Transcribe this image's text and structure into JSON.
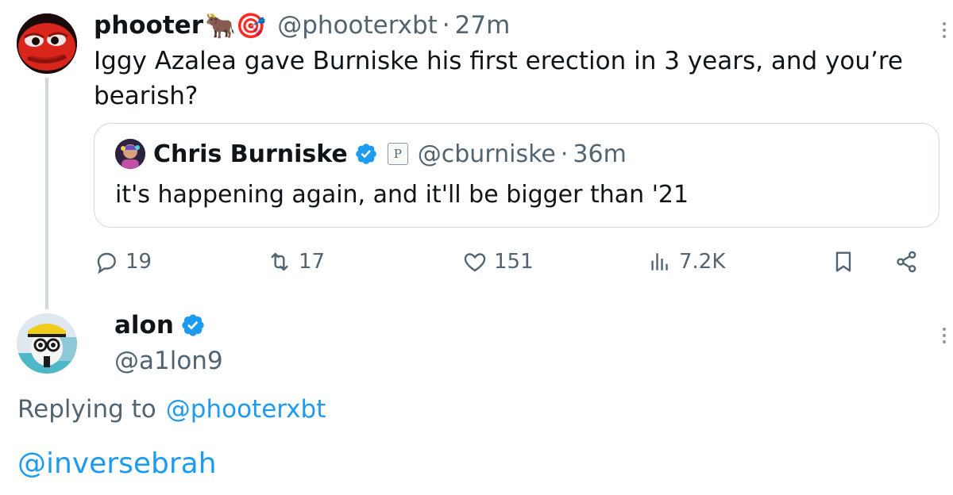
{
  "colors": {
    "text": "#0f1419",
    "secondary": "#536471",
    "link": "#1d9bf0",
    "border": "#cfd9de",
    "verified": "#1d9bf0"
  },
  "tweet": {
    "name": "phooter",
    "emojis": "🐂🎯",
    "handle": "@phooterxbt",
    "separator": "·",
    "time": "27m",
    "text": "Iggy Azalea gave Burniske his first erection in 3 years, and you’re bearish?",
    "quote": {
      "name": "Chris Burniske",
      "badge_letter": "P",
      "handle": "@cburniske",
      "separator": "·",
      "time": "36m",
      "text": "it's happening again, and it'll be bigger than '21"
    },
    "actions": {
      "replies": "19",
      "retweets": "17",
      "likes": "151",
      "views": "7.2K"
    }
  },
  "reply": {
    "name": "alon",
    "handle": "@a1lon9",
    "replying_prefix": "Replying to",
    "replying_to": "@phooterxbt",
    "body": "@inversebrah"
  },
  "icons": {
    "reply": "comment-icon",
    "retweet": "retweet-icon",
    "like": "heart-icon",
    "views": "analytics-icon",
    "bookmark": "bookmark-icon",
    "share": "share-icon",
    "more": "more-dots-icon",
    "verified": "verified-badge-icon"
  }
}
